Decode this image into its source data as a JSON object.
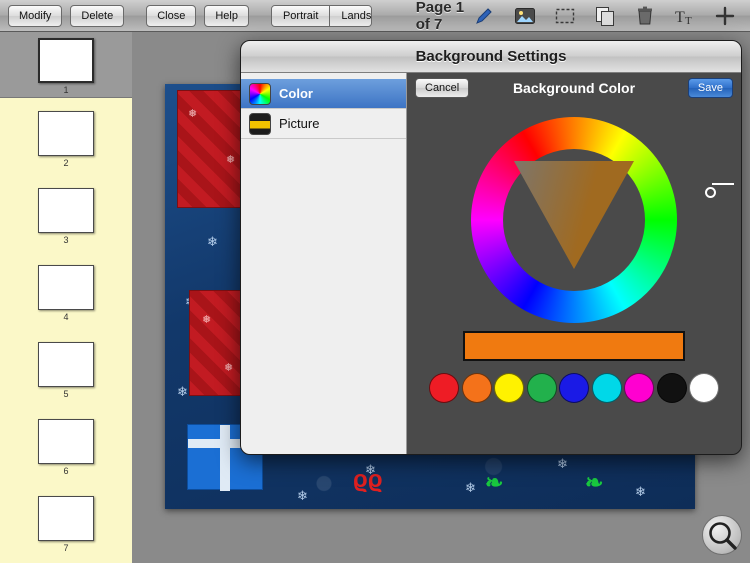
{
  "toolbar": {
    "modify_label": "Modify",
    "delete_label": "Delete",
    "close_label": "Close",
    "help_label": "Help",
    "orientation": {
      "portrait_label": "Portrait",
      "landscape_label": "Landscape",
      "selected": "Portrait"
    },
    "page_label": "Page 1 of 7",
    "icons": [
      "pen-icon",
      "image-icon",
      "selection-icon",
      "duplicate-icon",
      "trash-icon",
      "text-icon",
      "add-icon"
    ]
  },
  "pagestrip": {
    "thumbnails": [
      {
        "number": "1",
        "selected": true
      },
      {
        "number": "2",
        "selected": false
      },
      {
        "number": "3",
        "selected": false
      },
      {
        "number": "4",
        "selected": false
      },
      {
        "number": "5",
        "selected": false
      },
      {
        "number": "6",
        "selected": false
      },
      {
        "number": "7",
        "selected": false
      }
    ]
  },
  "modal": {
    "title": "Background Settings",
    "options": [
      {
        "label": "Color",
        "icon": "color-wheel-icon",
        "active": true
      },
      {
        "label": "Picture",
        "icon": "picture-icon",
        "active": false
      }
    ],
    "panel": {
      "cancel_label": "Cancel",
      "header_title": "Background Color",
      "save_label": "Save",
      "selected_color": "#f07a10",
      "palette": [
        "#ee1c25",
        "#f4721a",
        "#fff200",
        "#22b14c",
        "#1a1ae6",
        "#00d8e8",
        "#ff00d0",
        "#111111",
        "#ffffff"
      ]
    }
  },
  "canvas": {
    "zoom_button": "magnifier-icon"
  }
}
